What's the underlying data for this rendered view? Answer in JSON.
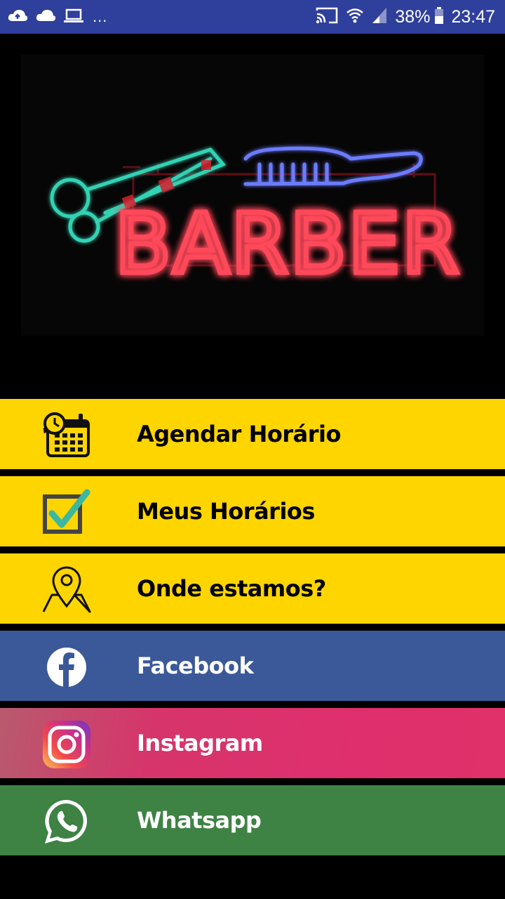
{
  "status_bar": {
    "left_icons": [
      "cloud-up-icon",
      "cloud-icon",
      "laptop-icon"
    ],
    "overflow": "...",
    "right_icons": [
      "cast-icon",
      "wifi-icon",
      "signal-icon",
      "battery-icon"
    ],
    "battery": "38%",
    "time": "23:47"
  },
  "hero": {
    "sign_text": "BARBER"
  },
  "menu": {
    "items": [
      {
        "label": "Agendar Horário",
        "icon": "calendar-clock-icon"
      },
      {
        "label": "Meus Horários",
        "icon": "checkbox-icon"
      },
      {
        "label": "Onde estamos?",
        "icon": "map-pin-icon"
      },
      {
        "label": "Facebook",
        "icon": "facebook-icon"
      },
      {
        "label": "Instagram",
        "icon": "instagram-icon"
      },
      {
        "label": "Whatsapp",
        "icon": "whatsapp-icon"
      }
    ]
  },
  "colors": {
    "status_bar": "#2F3F9C",
    "yellow_button": "#FFD500",
    "facebook": "#3B5998",
    "instagram": "#DF2F6C",
    "whatsapp": "#3E8244",
    "background": "#000000"
  }
}
